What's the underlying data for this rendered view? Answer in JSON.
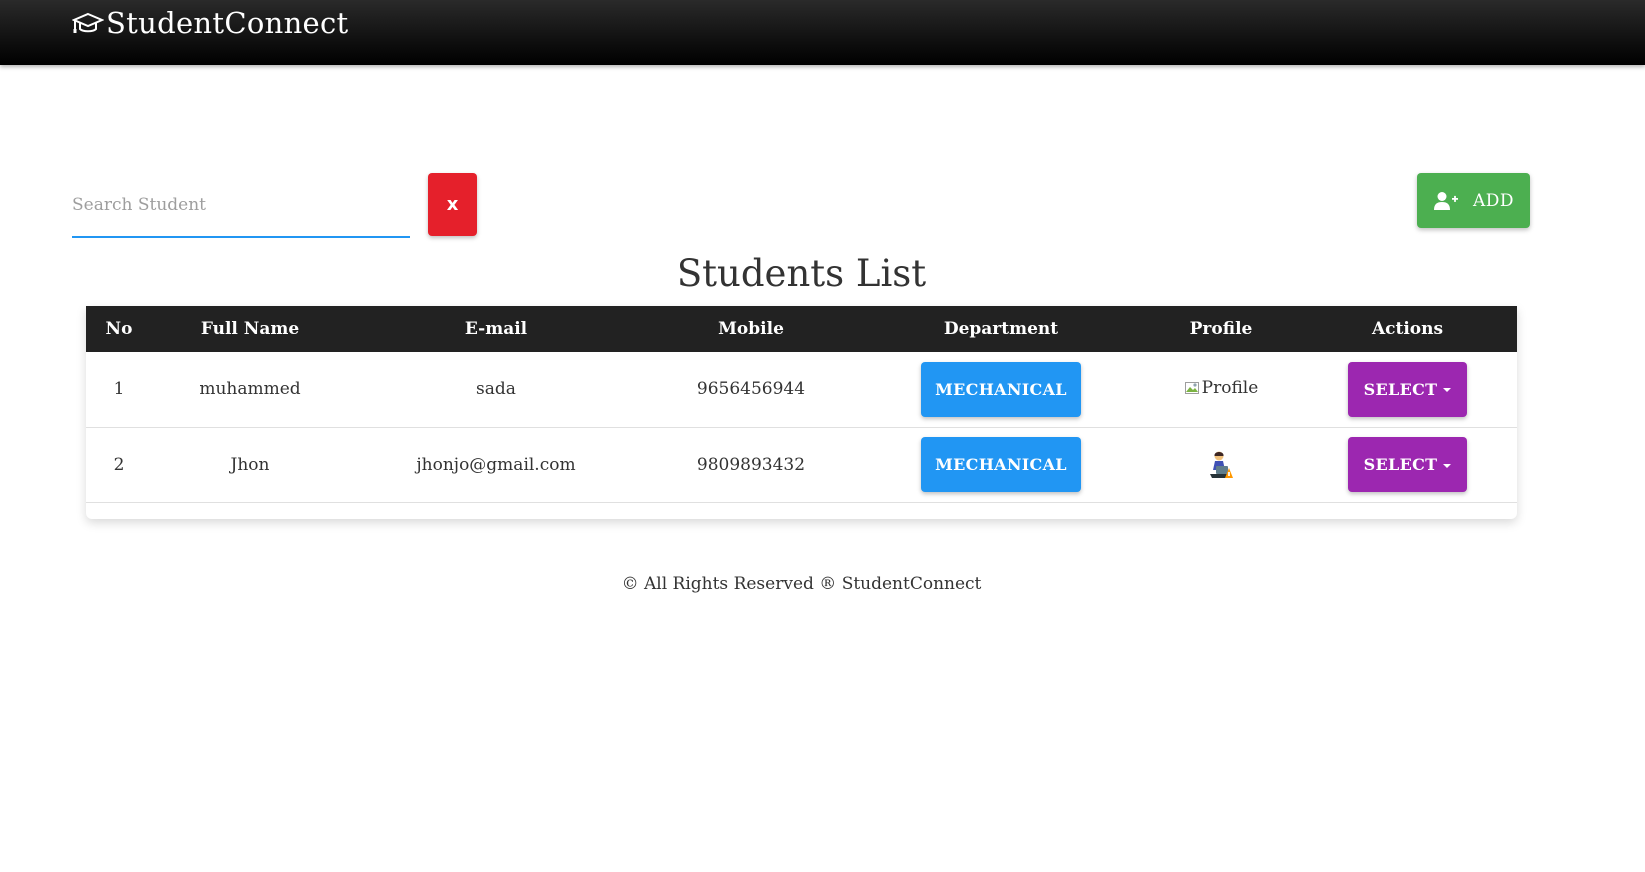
{
  "navbar": {
    "brand": "StudentConnect",
    "brand_icon": "graduation-cap-icon"
  },
  "search": {
    "placeholder": "Search Student",
    "value": "",
    "clear_label": "x"
  },
  "add_button": {
    "label": "ADD",
    "icon": "user-plus-icon",
    "color": "#4caf50"
  },
  "page_title": "Students List",
  "table": {
    "headers": [
      "No",
      "Full Name",
      "E-mail",
      "Mobile",
      "Department",
      "Profile",
      "Actions"
    ],
    "rows": [
      {
        "no": "1",
        "full_name": "muhammed",
        "email": "sada",
        "mobile": "9656456944",
        "department": "MECHANICAL",
        "profile_alt": "Profile",
        "profile_type": "broken-image",
        "action_label": "SELECT"
      },
      {
        "no": "2",
        "full_name": "Jhon",
        "email": "jhonjo@gmail.com",
        "mobile": "9809893432",
        "department": "MECHANICAL",
        "profile_alt": "Profile",
        "profile_type": "avatar-image",
        "action_label": "SELECT"
      }
    ]
  },
  "footer": "© All Rights Reserved ® StudentConnect",
  "colors": {
    "navbar": "#111111",
    "danger": "#e5202b",
    "success": "#4caf50",
    "primary": "#2196f3",
    "secondary": "#9c27b0",
    "table_header": "#222222"
  }
}
